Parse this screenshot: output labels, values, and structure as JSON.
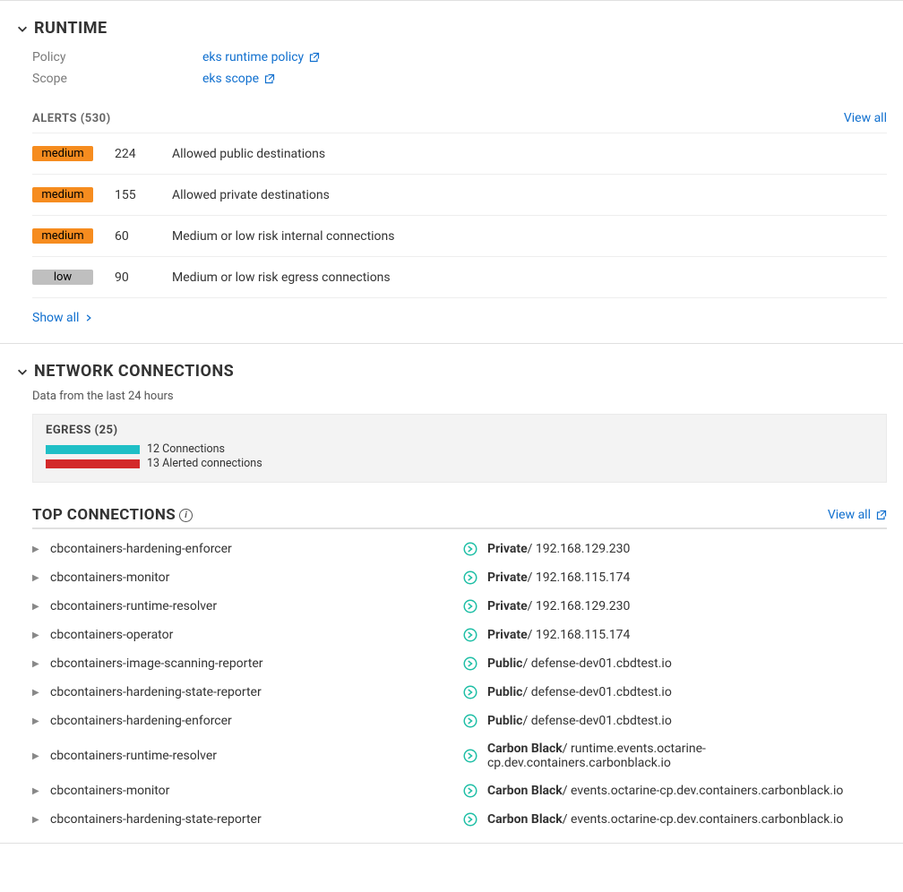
{
  "runtime": {
    "title": "RUNTIME",
    "policy_label": "Policy",
    "policy_value": "eks runtime policy",
    "scope_label": "Scope",
    "scope_value": "eks scope",
    "alerts_heading": "ALERTS (530)",
    "view_all": "View all",
    "alerts": [
      {
        "severity": "medium",
        "count": "224",
        "desc": "Allowed public destinations"
      },
      {
        "severity": "medium",
        "count": "155",
        "desc": "Allowed private destinations"
      },
      {
        "severity": "medium",
        "count": "60",
        "desc": "Medium or low risk internal connections"
      },
      {
        "severity": "low",
        "count": "90",
        "desc": "Medium or low risk egress connections"
      }
    ],
    "show_all": "Show all"
  },
  "network": {
    "title": "NETWORK CONNECTIONS",
    "subtitle": "Data from the last 24 hours",
    "egress_title": "EGRESS (25)",
    "conn_label": "12 Connections",
    "alerted_label": "13 Alerted connections",
    "top_title": "TOP CONNECTIONS",
    "view_all": "View all",
    "connections": [
      {
        "name": "cbcontainers-hardening-enforcer",
        "scope": "Private",
        "host": "192.168.129.230"
      },
      {
        "name": "cbcontainers-monitor",
        "scope": "Private",
        "host": "192.168.115.174"
      },
      {
        "name": "cbcontainers-runtime-resolver",
        "scope": "Private",
        "host": "192.168.129.230"
      },
      {
        "name": "cbcontainers-operator",
        "scope": "Private",
        "host": "192.168.115.174"
      },
      {
        "name": "cbcontainers-image-scanning-reporter",
        "scope": "Public",
        "host": "defense-dev01.cbdtest.io"
      },
      {
        "name": "cbcontainers-hardening-state-reporter",
        "scope": "Public",
        "host": "defense-dev01.cbdtest.io"
      },
      {
        "name": "cbcontainers-hardening-enforcer",
        "scope": "Public",
        "host": "defense-dev01.cbdtest.io"
      },
      {
        "name": "cbcontainers-runtime-resolver",
        "scope": "Carbon Black",
        "host": "runtime.events.octarine-cp.dev.containers.carbonblack.io"
      },
      {
        "name": "cbcontainers-monitor",
        "scope": "Carbon Black",
        "host": "events.octarine-cp.dev.containers.carbonblack.io"
      },
      {
        "name": "cbcontainers-hardening-state-reporter",
        "scope": "Carbon Black",
        "host": "events.octarine-cp.dev.containers.carbonblack.io"
      }
    ]
  }
}
